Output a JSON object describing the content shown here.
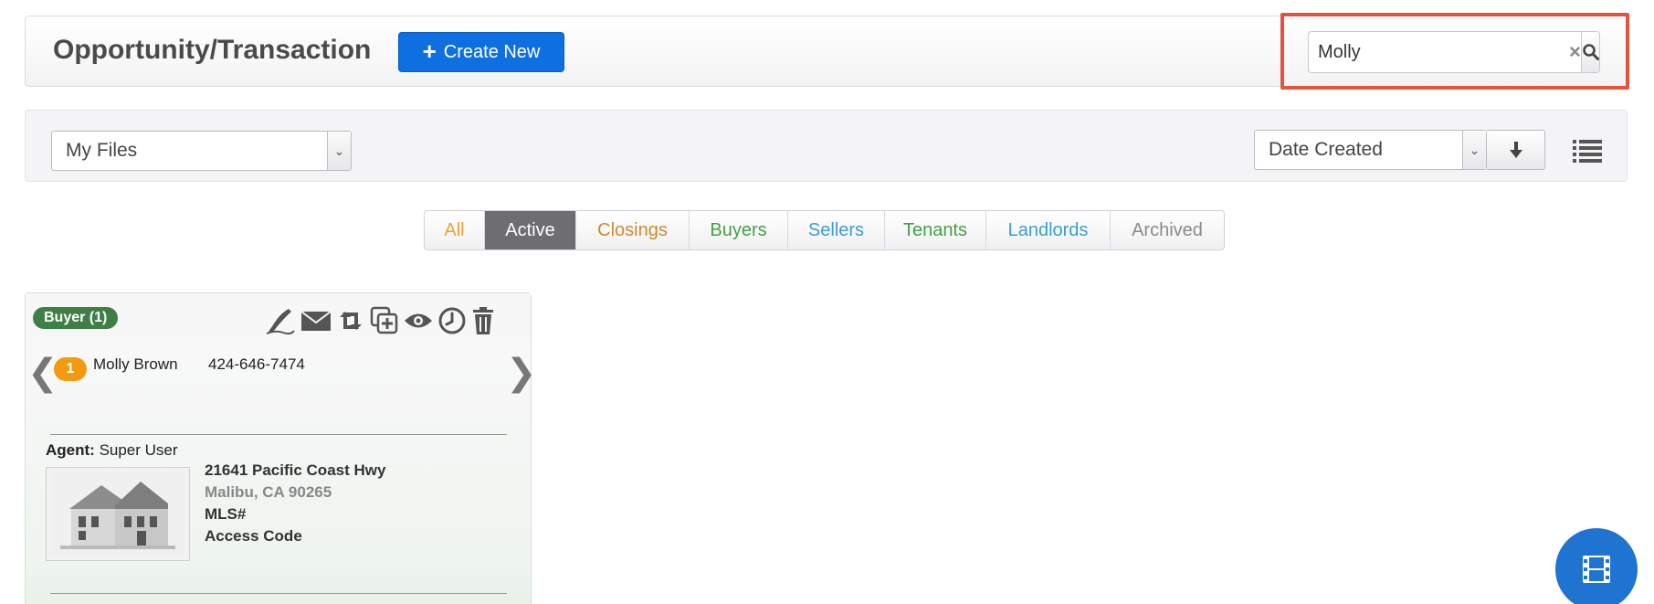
{
  "header": {
    "title": "Opportunity/Transaction",
    "create_label": "Create New",
    "search": {
      "value": "Molly",
      "clear_glyph": "×"
    }
  },
  "filters": {
    "files_select": "My Files",
    "sort_select": "Date Created"
  },
  "tabs": [
    {
      "label": "All",
      "color": "#f0a030",
      "active": false
    },
    {
      "label": "Active",
      "color": "#ffffff",
      "active": true
    },
    {
      "label": "Closings",
      "color": "#cc8a2e",
      "active": false
    },
    {
      "label": "Buyers",
      "color": "#44a044",
      "active": false
    },
    {
      "label": "Sellers",
      "color": "#3a9ed0",
      "active": false
    },
    {
      "label": "Tenants",
      "color": "#44a044",
      "active": false
    },
    {
      "label": "Landlords",
      "color": "#3a9ed0",
      "active": false
    },
    {
      "label": "Archived",
      "color": "#8a8a8a",
      "active": false
    }
  ],
  "card": {
    "badge": "Buyer (1)",
    "icons": [
      "signature-icon",
      "mail-icon",
      "retweet-icon",
      "duplicate-icon",
      "eye-icon",
      "clock-icon",
      "trash-icon"
    ],
    "prev_glyph": "❮",
    "next_glyph": "❯",
    "contact": {
      "index": "1",
      "name": "Molly Brown",
      "phone": "424-646-7474"
    },
    "agent_label": "Agent:",
    "agent_name": "Super User",
    "address_line1": "21641 Pacific Coast Hwy",
    "address_line2": "Malibu, CA 90265",
    "mls_label": "MLS#",
    "access_label": "Access Code"
  },
  "colors": {
    "primary": "#0e6fe0",
    "highlight": "#e5533d",
    "badge_green": "#3f7f46",
    "badge_orange": "#f19a12"
  }
}
